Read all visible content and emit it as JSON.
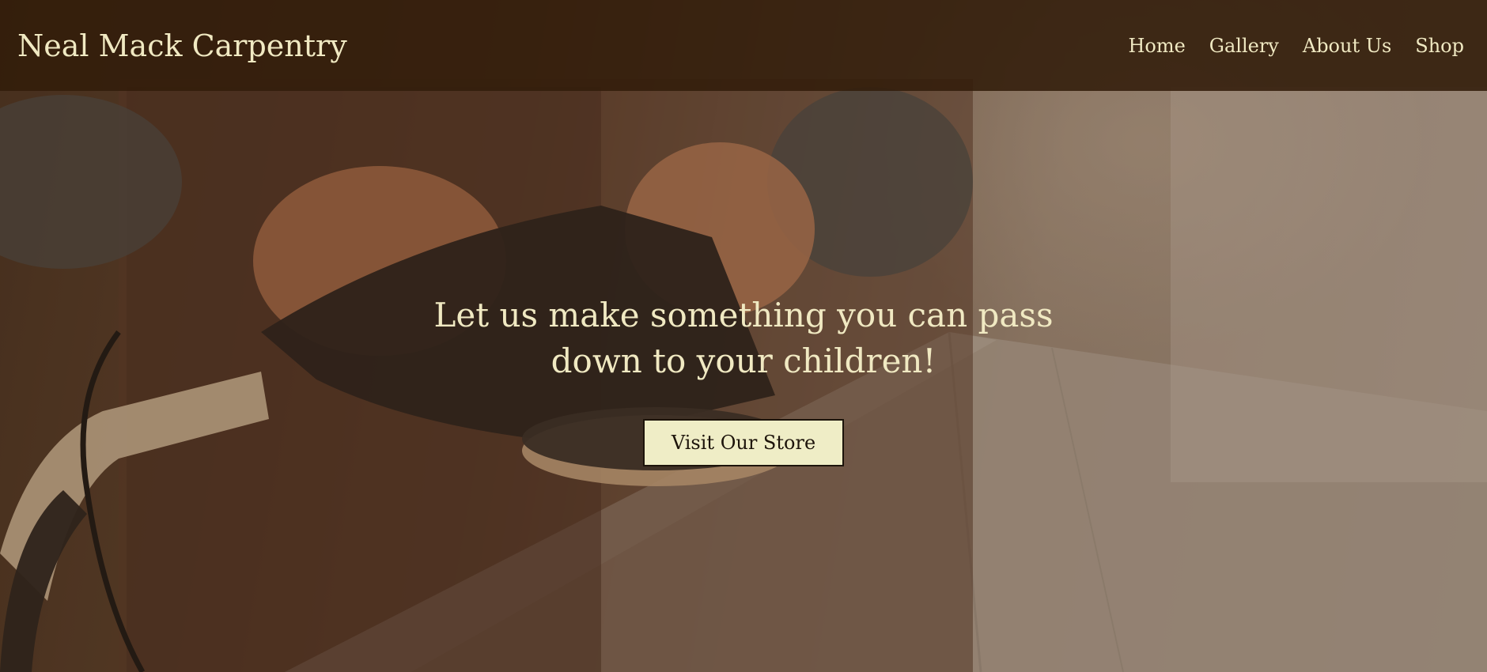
{
  "header": {
    "brand": "Neal Mack Carpentry",
    "nav": [
      {
        "label": "Home"
      },
      {
        "label": "Gallery"
      },
      {
        "label": "About Us"
      },
      {
        "label": "Shop"
      }
    ]
  },
  "hero": {
    "headline": "Let us make something you can pass down to your children!",
    "cta_label": "Visit Our Store"
  },
  "colors": {
    "header_bg": "#321c0a",
    "text_cream": "#f0e9c2",
    "button_bg": "#efedc6",
    "button_text": "#1d140b"
  }
}
